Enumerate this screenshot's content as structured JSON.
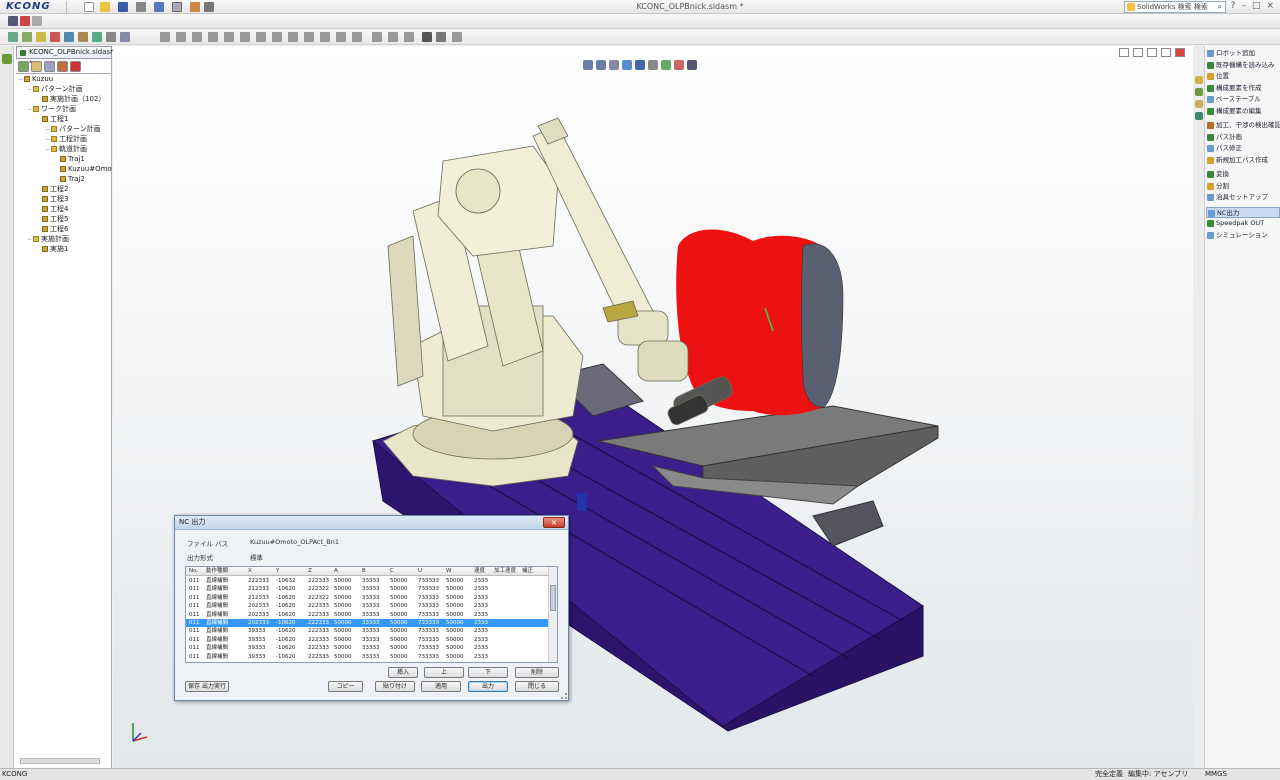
{
  "app": {
    "logo": "KCONG",
    "title": "KCONC_OLPBnick.sldasm *",
    "search_placeholder": "SolidWorks 検索 検索",
    "window_controls": [
      "?",
      "–",
      "□",
      "×"
    ]
  },
  "document": {
    "tab_label": "KCONC_OLPBnick.sldasm *"
  },
  "tree": {
    "items": [
      {
        "label": "Kuzuu",
        "indent": 0,
        "kind": "root"
      },
      {
        "label": "パターン計画",
        "indent": 1,
        "kind": "folder"
      },
      {
        "label": "実施計画（102）",
        "indent": 2,
        "kind": "op"
      },
      {
        "label": "ワーク計画",
        "indent": 1,
        "kind": "folder"
      },
      {
        "label": "工程1",
        "indent": 2,
        "kind": "op"
      },
      {
        "label": "パターン計画",
        "indent": 3,
        "kind": "folder"
      },
      {
        "label": "工程計画",
        "indent": 3,
        "kind": "folder"
      },
      {
        "label": "軌道計画",
        "indent": 3,
        "kind": "folder"
      },
      {
        "label": "Traj1",
        "indent": 4,
        "kind": "op"
      },
      {
        "label": "Kuzuu#Omoto_",
        "indent": 4,
        "kind": "op"
      },
      {
        "label": "Traj2",
        "indent": 4,
        "kind": "op"
      },
      {
        "label": "工程2",
        "indent": 2,
        "kind": "op"
      },
      {
        "label": "工程3",
        "indent": 2,
        "kind": "op"
      },
      {
        "label": "工程4",
        "indent": 2,
        "kind": "op"
      },
      {
        "label": "工程5",
        "indent": 2,
        "kind": "op"
      },
      {
        "label": "工程6",
        "indent": 2,
        "kind": "op"
      },
      {
        "label": "実施計画",
        "indent": 1,
        "kind": "folder"
      },
      {
        "label": "実施1",
        "indent": 2,
        "kind": "op"
      }
    ]
  },
  "task_pane": {
    "items": [
      {
        "label": "ロボット追加",
        "color": "#6a9ad0"
      },
      {
        "label": "既存機構を読み込み",
        "color": "#3a8a3a"
      },
      {
        "label": "位置",
        "color": "#d4a030"
      },
      {
        "label": "構成要素を作成",
        "color": "#3a8a3a"
      },
      {
        "label": "ベーステーブル",
        "color": "#6a9ad0"
      },
      {
        "label": "構成要素の編集",
        "color": "#3a8a3a"
      },
      {
        "label": "加工、干渉の検出確認",
        "color": "#c06a2a"
      },
      {
        "label": "パス計画",
        "color": "#3a8a3a"
      },
      {
        "label": "パス修正",
        "color": "#6a9ad0"
      },
      {
        "label": "新規加工パス作成",
        "color": "#d4a030"
      },
      {
        "label": "変換",
        "color": "#3a8a3a"
      },
      {
        "label": "分割",
        "color": "#d4a030"
      },
      {
        "label": "治具セットアップ",
        "color": "#6a9ad0"
      },
      {
        "label": "NC出力",
        "color": "#6a9ad0",
        "selected": true
      },
      {
        "label": "Speedpak OUT",
        "color": "#3a8a3a"
      },
      {
        "label": "シミュレーション",
        "color": "#6a9ad0"
      }
    ]
  },
  "nc_dialog": {
    "title": "NC 出力",
    "close_label": "×",
    "field1_label": "ファイル パス",
    "field1_value": "Kuzuu#Omoto_OLPAct_Bn1",
    "field2_label": "出力形式",
    "field2_value": "標準",
    "columns": [
      "No.",
      "動作種類",
      "X",
      "Y",
      "Z",
      "A",
      "B",
      "C",
      "U",
      "W",
      "速度",
      "加工速度",
      "補正"
    ],
    "rows": [
      [
        "011",
        "直線補間",
        "222333",
        "-10632",
        "222333",
        "50000",
        "33333",
        "50000",
        "733333",
        "50000",
        "2333"
      ],
      [
        "011",
        "直線補間",
        "212333",
        "-10620",
        "222322",
        "50000",
        "33333",
        "50000",
        "733333",
        "50000",
        "2333"
      ],
      [
        "011",
        "直線補間",
        "212333",
        "-10620",
        "222322",
        "50000",
        "33333",
        "50000",
        "733333",
        "50000",
        "2333"
      ],
      [
        "011",
        "直線補間",
        "202333",
        "-10620",
        "222333",
        "50000",
        "33333",
        "50000",
        "733333",
        "50000",
        "2333"
      ],
      [
        "011",
        "直線補間",
        "202333",
        "-10620",
        "222333",
        "50000",
        "33333",
        "50000",
        "733333",
        "50000",
        "2333"
      ],
      [
        "011",
        "直線補間",
        "202333",
        "-10620",
        "222333",
        "50000",
        "33333",
        "50000",
        "733333",
        "50000",
        "2333"
      ],
      [
        "011",
        "直線補間",
        "39333",
        "-10620",
        "222333",
        "50000",
        "33333",
        "50000",
        "733333",
        "50000",
        "2333"
      ],
      [
        "011",
        "直線補間",
        "39333",
        "-10620",
        "222333",
        "50000",
        "33333",
        "50000",
        "733333",
        "50000",
        "2333"
      ],
      [
        "011",
        "直線補間",
        "39333",
        "-10620",
        "222333",
        "50000",
        "33333",
        "50000",
        "733333",
        "50000",
        "2333"
      ],
      [
        "011",
        "直線補間",
        "39333",
        "-10620",
        "222333",
        "50000",
        "33333",
        "50000",
        "733333",
        "50000",
        "2333"
      ]
    ],
    "selected_row": 5,
    "buttons_top": [
      "挿入",
      "上",
      "下",
      "削除"
    ],
    "buttons_bottom": [
      "コピー",
      "貼り付け",
      "適用",
      "出力",
      "閉じる"
    ],
    "button_left": "保存 出力実行"
  },
  "statusbar": {
    "left": "KCONG",
    "r1": "完全定義",
    "r2": "編集中: アセンブリ",
    "r3": "MMGS"
  }
}
